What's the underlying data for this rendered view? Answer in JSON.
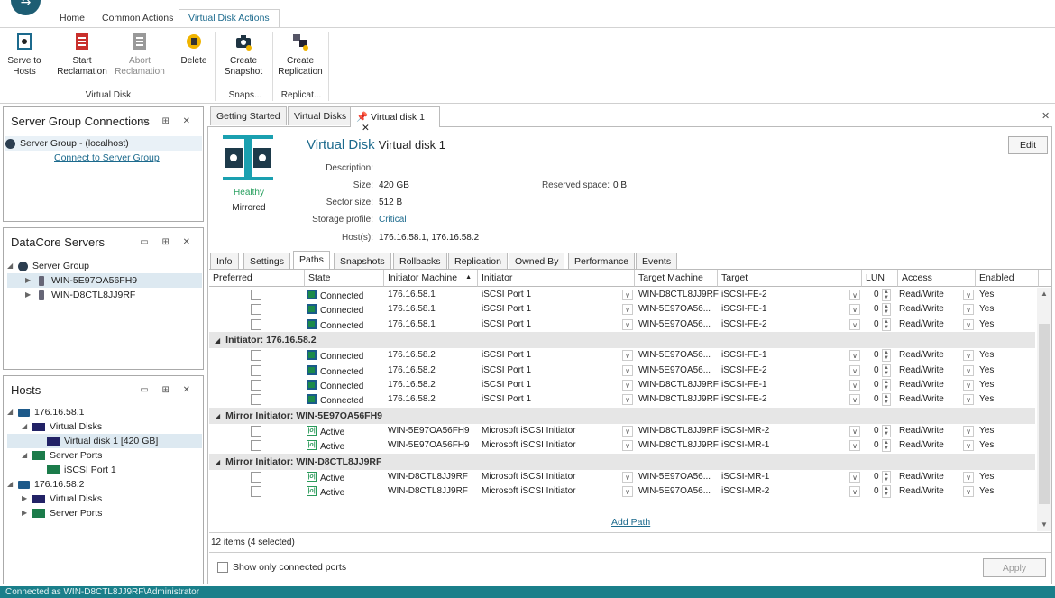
{
  "ribbon": {
    "tabs": [
      "Home",
      "Common Actions",
      "Virtual Disk Actions"
    ],
    "buttons": [
      {
        "label1": "Serve to",
        "label2": "Hosts",
        "icon": "serve-to-hosts-icon"
      },
      {
        "label1": "Start",
        "label2": "Reclamation",
        "icon": "start-reclamation-icon"
      },
      {
        "label1": "Abort",
        "label2": "Reclamation",
        "icon": "abort-reclamation-icon"
      },
      {
        "label1": "Delete",
        "label2": "",
        "icon": "delete-icon"
      },
      {
        "label1": "Create",
        "label2": "Snapshot",
        "icon": "camera-icon"
      },
      {
        "label1": "Create",
        "label2": "Replication",
        "icon": "replication-icon"
      }
    ],
    "groups": [
      "Virtual Disk",
      "Snaps...",
      "Replicat..."
    ]
  },
  "server_group_panel": {
    "title": "Server Group Connections",
    "group": "Server Group - (localhost)",
    "link": "Connect to Server Group"
  },
  "datacore_panel": {
    "title": "DataCore Servers",
    "root": "Server Group",
    "servers": [
      "WIN-5E97OA56FH9",
      "WIN-D8CTL8JJ9RF"
    ]
  },
  "hosts_panel": {
    "title": "Hosts",
    "host1": "176.16.58.1",
    "virtual_disks": "Virtual Disks",
    "vd1": "Virtual disk 1  [420 GB]",
    "server_ports": "Server Ports",
    "port1": "iSCSI Port 1",
    "host2": "176.16.58.2",
    "virtual_disks2": "Virtual Disks",
    "server_ports2": "Server Ports"
  },
  "doc_tabs": [
    "Getting Started",
    "Virtual Disks",
    "Virtual disk 1"
  ],
  "vdisk": {
    "heading_type": "Virtual Disk",
    "heading_name": "Virtual disk 1",
    "edit": "Edit",
    "health": "Healthy",
    "mode": "Mirrored",
    "labels": {
      "description": "Description:",
      "size": "Size:",
      "sector": "Sector size:",
      "profile": "Storage profile:",
      "hosts": "Host(s):",
      "reserved": "Reserved space:"
    },
    "size": "420 GB",
    "sector": "512 B",
    "profile": "Critical",
    "hosts": "176.16.58.1, 176.16.58.2",
    "reserved": "0 B"
  },
  "sub_tabs": [
    "Info",
    "Settings",
    "Paths",
    "Snapshots",
    "Rollbacks",
    "Replication",
    "Owned By",
    "Performance",
    "Events"
  ],
  "grid": {
    "headers": [
      "Preferred",
      "State",
      "Initiator Machine",
      "Initiator",
      "Target Machine",
      "Target",
      "LUN",
      "Access",
      "Enabled"
    ],
    "group_rows": [
      {
        "title": "",
        "rows": [
          [
            "Connected",
            "176.16.58.1",
            "iSCSI Port 1",
            "WIN-D8CTL8JJ9RF",
            "iSCSI-FE-2",
            "0",
            "Read/Write",
            "Yes"
          ],
          [
            "Connected",
            "176.16.58.1",
            "iSCSI Port 1",
            "WIN-5E97OA56...",
            "iSCSI-FE-1",
            "0",
            "Read/Write",
            "Yes"
          ],
          [
            "Connected",
            "176.16.58.1",
            "iSCSI Port 1",
            "WIN-5E97OA56...",
            "iSCSI-FE-2",
            "0",
            "Read/Write",
            "Yes"
          ]
        ]
      },
      {
        "title": "Initiator: 176.16.58.2",
        "rows": [
          [
            "Connected",
            "176.16.58.2",
            "iSCSI Port 1",
            "WIN-5E97OA56...",
            "iSCSI-FE-1",
            "0",
            "Read/Write",
            "Yes"
          ],
          [
            "Connected",
            "176.16.58.2",
            "iSCSI Port 1",
            "WIN-5E97OA56...",
            "iSCSI-FE-2",
            "0",
            "Read/Write",
            "Yes"
          ],
          [
            "Connected",
            "176.16.58.2",
            "iSCSI Port 1",
            "WIN-D8CTL8JJ9RF",
            "iSCSI-FE-1",
            "0",
            "Read/Write",
            "Yes"
          ],
          [
            "Connected",
            "176.16.58.2",
            "iSCSI Port 1",
            "WIN-D8CTL8JJ9RF",
            "iSCSI-FE-2",
            "0",
            "Read/Write",
            "Yes"
          ]
        ]
      },
      {
        "title": "Mirror Initiator: WIN-5E97OA56FH9",
        "rows": [
          [
            "Active",
            "WIN-5E97OA56FH9",
            "Microsoft iSCSI Initiator",
            "WIN-D8CTL8JJ9RF",
            "iSCSI-MR-2",
            "0",
            "Read/Write",
            "Yes"
          ],
          [
            "Active",
            "WIN-5E97OA56FH9",
            "Microsoft iSCSI Initiator",
            "WIN-D8CTL8JJ9RF",
            "iSCSI-MR-1",
            "0",
            "Read/Write",
            "Yes"
          ]
        ]
      },
      {
        "title": "Mirror Initiator: WIN-D8CTL8JJ9RF",
        "rows": [
          [
            "Active",
            "WIN-D8CTL8JJ9RF",
            "Microsoft iSCSI Initiator",
            "WIN-5E97OA56...",
            "iSCSI-MR-1",
            "0",
            "Read/Write",
            "Yes"
          ],
          [
            "Active",
            "WIN-D8CTL8JJ9RF",
            "Microsoft iSCSI Initiator",
            "WIN-5E97OA56...",
            "iSCSI-MR-2",
            "0",
            "Read/Write",
            "Yes"
          ]
        ]
      }
    ],
    "add_path": "Add Path",
    "footer": "12 items (4 selected)",
    "show_only": "Show only connected ports",
    "apply": "Apply"
  },
  "status": "Connected as WIN-D8CTL8JJ9RF\\Administrator",
  "colors": {
    "accent": "#1c6a8d",
    "status_bar": "#1a7f8a",
    "group_row": "#e6e6e6"
  }
}
